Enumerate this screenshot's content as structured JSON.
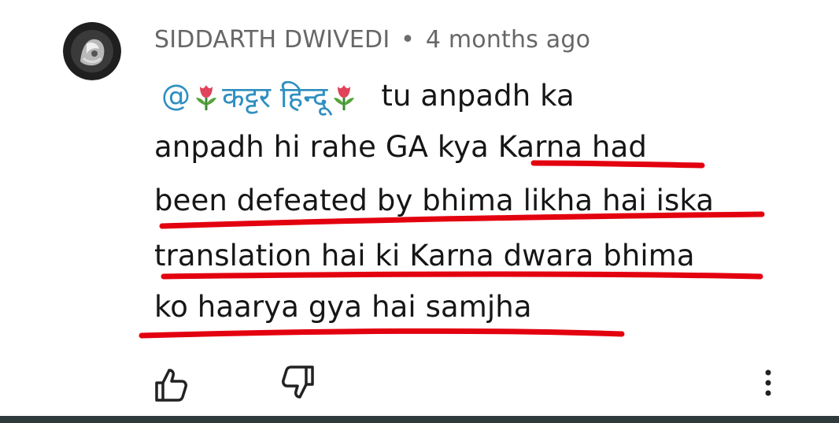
{
  "comment": {
    "author": "SIDDARTH DWIVEDI",
    "separator": "•",
    "time_ago": "4 months ago",
    "mention_prefix": "@",
    "mention_name": "कट्टर हिन्दू",
    "lines": [
      "tu anpadh ka",
      "anpadh hi rahe GA kya Karna had",
      "been defeated by bhima likha hai iska",
      "translation hai ki Karna dwara bhima",
      "ko haarya gya hai samjha"
    ]
  },
  "actions": {
    "like_icon": "thumbs-up-icon",
    "dislike_icon": "thumbs-down-icon",
    "more_icon": "more-vertical-icon"
  },
  "colors": {
    "author_text": "#676767",
    "mention_text": "#2e8fc0",
    "body_text": "#161616",
    "underline": "#e3000f",
    "bottom_bar": "#2e3a3c"
  }
}
